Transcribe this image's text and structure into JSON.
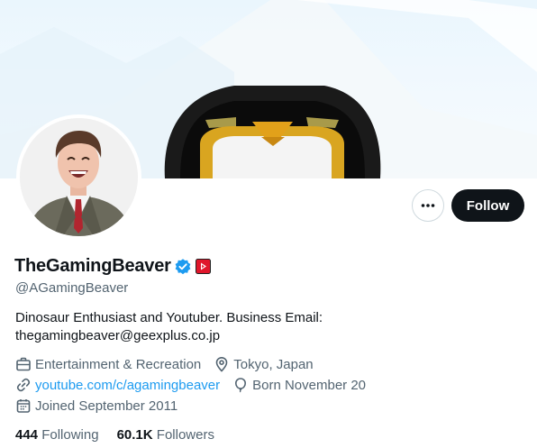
{
  "profile": {
    "display_name": "TheGamingBeaver",
    "handle": "@AGamingBeaver",
    "bio": "Dinosaur Enthusiast and Youtuber. Business Email: thegamingbeaver@geexplus.co.jp",
    "category": "Entertainment & Recreation",
    "location": "Tokyo, Japan",
    "website": "youtube.com/c/agamingbeaver",
    "birthday": "Born November 20",
    "joined": "Joined September 2011"
  },
  "actions": {
    "follow_label": "Follow"
  },
  "stats": {
    "following_count": "444",
    "following_label": "Following",
    "followers_count": "60.1K",
    "followers_label": "Followers"
  },
  "colors": {
    "accent": "#1d9bf0",
    "text_primary": "#0f1419",
    "text_secondary": "#536471",
    "follow_button": "#0f1419",
    "youtube_badge": "#e0162b"
  },
  "icons": {
    "verified": "verified-badge-icon",
    "youtube": "youtube-affiliate-icon",
    "more": "more-horizontal-icon",
    "category": "briefcase-icon",
    "location": "location-pin-icon",
    "website": "link-icon",
    "birthday": "balloon-icon",
    "joined": "calendar-icon"
  }
}
